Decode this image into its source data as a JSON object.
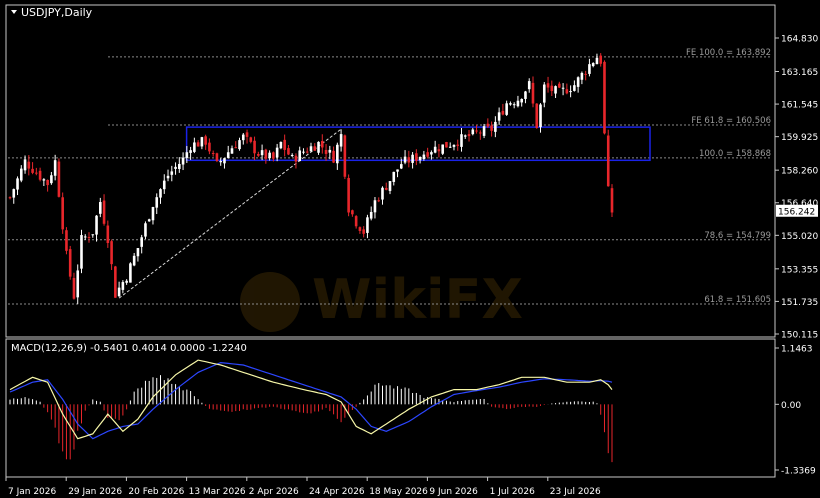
{
  "symbol_title": "USDJPY,Daily",
  "watermark": "WikiFX",
  "colors": {
    "background": "#000000",
    "frame": "#c8c8c8",
    "bull": "#ffffff",
    "bear": "#e8262b",
    "zone": "#1a22e8",
    "level_line": "#8a8a8a",
    "text": "#ffffff",
    "level_text": "#9a9a9a",
    "macd_line": "#f7f7a8",
    "signal_line": "#2c46ff",
    "hist_pos": "#ffffff",
    "hist_neg": "#e8262b",
    "price_box_bg": "#ffffff",
    "price_box_fg": "#000000"
  },
  "chart_data": [
    {
      "type": "candlestick",
      "title": "USDJPY,Daily",
      "y_ticks": [
        "164.830",
        "163.165",
        "161.545",
        "159.925",
        "158.260",
        "156.640",
        "155.020",
        "153.355",
        "151.735",
        "150.115"
      ],
      "ylim": [
        150.115,
        164.83
      ],
      "current_price": "156.242",
      "x_labels": [
        "7 Jan 2026",
        "29 Jan 2026",
        "20 Feb 2026",
        "13 Mar 2026",
        "2 Apr 2026",
        "24 Apr 2026",
        "18 May 2026",
        "9 Jun 2026",
        "1 Jul 2026",
        "23 Jul 2026"
      ],
      "levels": [
        {
          "label": "FE 100.0 = 163.892",
          "value": 163.892
        },
        {
          "label": "FE 61.8 = 160.506",
          "value": 160.506
        },
        {
          "label": "100.0 = 158.868",
          "value": 158.868
        },
        {
          "label": "78.6 = 154.799",
          "value": 154.799
        },
        {
          "label": "61.8 = 151.605",
          "value": 151.605
        }
      ],
      "zone": {
        "from_label": "13 Mar 2026",
        "to_label": "23 Jul 2026",
        "high": 160.4,
        "low": 158.75
      },
      "trendline": {
        "from_value": 151.9,
        "to_value": 160.3
      },
      "keypoints": [
        [
          0,
          156.9
        ],
        [
          4,
          158.7
        ],
        [
          10,
          157.6
        ],
        [
          12,
          158.7
        ],
        [
          15,
          154.0
        ],
        [
          17,
          152.0
        ],
        [
          19,
          154.8
        ],
        [
          22,
          155.2
        ],
        [
          24,
          156.7
        ],
        [
          26,
          154.9
        ],
        [
          28,
          152.1
        ],
        [
          31,
          153.0
        ],
        [
          34,
          154.4
        ],
        [
          38,
          156.6
        ],
        [
          42,
          158.0
        ],
        [
          46,
          158.8
        ],
        [
          48,
          159.5
        ],
        [
          52,
          159.7
        ],
        [
          55,
          158.5
        ],
        [
          59,
          159.4
        ],
        [
          62,
          159.9
        ],
        [
          66,
          159.1
        ],
        [
          70,
          158.8
        ],
        [
          72,
          159.6
        ],
        [
          75,
          158.8
        ],
        [
          78,
          159.2
        ],
        [
          82,
          159.6
        ],
        [
          86,
          158.9
        ],
        [
          88,
          160.0
        ],
        [
          90,
          156.4
        ],
        [
          92,
          155.7
        ],
        [
          94,
          155.2
        ],
        [
          97,
          156.7
        ],
        [
          100,
          157.5
        ],
        [
          104,
          158.6
        ],
        [
          108,
          158.9
        ],
        [
          112,
          159.3
        ],
        [
          116,
          159.5
        ],
        [
          120,
          159.8
        ],
        [
          124,
          160.1
        ],
        [
          128,
          160.3
        ],
        [
          132,
          161.6
        ],
        [
          135,
          161.8
        ],
        [
          138,
          162.5
        ],
        [
          140,
          160.5
        ],
        [
          142,
          162.4
        ],
        [
          146,
          162.1
        ],
        [
          150,
          162.5
        ],
        [
          154,
          163.5
        ],
        [
          156,
          163.9
        ],
        [
          157,
          163.7
        ],
        [
          158,
          160.0
        ],
        [
          159,
          157.2
        ],
        [
          160,
          156.2
        ]
      ]
    },
    {
      "type": "macd",
      "label": "MACD(12,26,9) -0.5401 0.4014 0.0000 -1.2240",
      "y_ticks": [
        "1.1463",
        "0.00",
        "-1.3369"
      ],
      "ylim": [
        -1.3369,
        1.1463
      ],
      "macd_keypoints": [
        [
          0,
          0.3
        ],
        [
          6,
          0.55
        ],
        [
          10,
          0.45
        ],
        [
          14,
          -0.2
        ],
        [
          18,
          -0.7
        ],
        [
          22,
          -0.6
        ],
        [
          26,
          -0.2
        ],
        [
          30,
          -0.55
        ],
        [
          34,
          -0.3
        ],
        [
          38,
          0.15
        ],
        [
          44,
          0.6
        ],
        [
          50,
          0.9
        ],
        [
          56,
          0.8
        ],
        [
          62,
          0.65
        ],
        [
          70,
          0.45
        ],
        [
          78,
          0.3
        ],
        [
          84,
          0.2
        ],
        [
          88,
          0.05
        ],
        [
          92,
          -0.45
        ],
        [
          96,
          -0.6
        ],
        [
          100,
          -0.4
        ],
        [
          106,
          -0.1
        ],
        [
          112,
          0.15
        ],
        [
          118,
          0.3
        ],
        [
          124,
          0.3
        ],
        [
          130,
          0.4
        ],
        [
          136,
          0.55
        ],
        [
          142,
          0.55
        ],
        [
          148,
          0.45
        ],
        [
          154,
          0.45
        ],
        [
          157,
          0.5
        ],
        [
          159,
          0.4
        ],
        [
          160,
          0.3
        ]
      ],
      "signal_keypoints": [
        [
          0,
          0.25
        ],
        [
          6,
          0.45
        ],
        [
          10,
          0.5
        ],
        [
          14,
          0.1
        ],
        [
          18,
          -0.4
        ],
        [
          22,
          -0.7
        ],
        [
          26,
          -0.55
        ],
        [
          30,
          -0.45
        ],
        [
          34,
          -0.4
        ],
        [
          38,
          -0.1
        ],
        [
          44,
          0.3
        ],
        [
          50,
          0.65
        ],
        [
          56,
          0.85
        ],
        [
          62,
          0.8
        ],
        [
          70,
          0.6
        ],
        [
          78,
          0.4
        ],
        [
          84,
          0.25
        ],
        [
          88,
          0.15
        ],
        [
          92,
          -0.1
        ],
        [
          96,
          -0.45
        ],
        [
          100,
          -0.55
        ],
        [
          106,
          -0.35
        ],
        [
          112,
          -0.05
        ],
        [
          118,
          0.2
        ],
        [
          124,
          0.28
        ],
        [
          130,
          0.35
        ],
        [
          136,
          0.45
        ],
        [
          142,
          0.52
        ],
        [
          148,
          0.5
        ],
        [
          154,
          0.47
        ],
        [
          157,
          0.48
        ],
        [
          159,
          0.47
        ],
        [
          160,
          0.45
        ]
      ],
      "hist_keypoints": [
        [
          0,
          0.1
        ],
        [
          4,
          0.15
        ],
        [
          8,
          0.05
        ],
        [
          11,
          -0.3
        ],
        [
          14,
          -0.95
        ],
        [
          16,
          -1.1
        ],
        [
          18,
          -0.6
        ],
        [
          20,
          -0.15
        ],
        [
          22,
          0.1
        ],
        [
          24,
          0.05
        ],
        [
          26,
          -0.3
        ],
        [
          29,
          -0.35
        ],
        [
          31,
          -0.1
        ],
        [
          33,
          0.25
        ],
        [
          36,
          0.45
        ],
        [
          40,
          0.6
        ],
        [
          44,
          0.4
        ],
        [
          48,
          0.25
        ],
        [
          50,
          0.1
        ],
        [
          53,
          -0.1
        ],
        [
          58,
          -0.15
        ],
        [
          64,
          -0.1
        ],
        [
          70,
          -0.05
        ],
        [
          76,
          -0.15
        ],
        [
          80,
          -0.2
        ],
        [
          84,
          -0.08
        ],
        [
          86,
          -0.2
        ],
        [
          88,
          -0.4
        ],
        [
          90,
          -0.2
        ],
        [
          92,
          -0.05
        ],
        [
          95,
          0.2
        ],
        [
          98,
          0.45
        ],
        [
          102,
          0.35
        ],
        [
          106,
          0.3
        ],
        [
          110,
          0.15
        ],
        [
          114,
          0.1
        ],
        [
          118,
          0.05
        ],
        [
          122,
          0.1
        ],
        [
          126,
          0.1
        ],
        [
          128,
          -0.05
        ],
        [
          132,
          -0.1
        ],
        [
          136,
          -0.05
        ],
        [
          140,
          -0.05
        ],
        [
          144,
          0.02
        ],
        [
          148,
          0.05
        ],
        [
          152,
          0.06
        ],
        [
          155,
          0.05
        ],
        [
          156,
          0.02
        ],
        [
          157,
          -0.2
        ],
        [
          158,
          -0.6
        ],
        [
          159,
          -0.95
        ],
        [
          160,
          -1.22
        ]
      ]
    }
  ]
}
